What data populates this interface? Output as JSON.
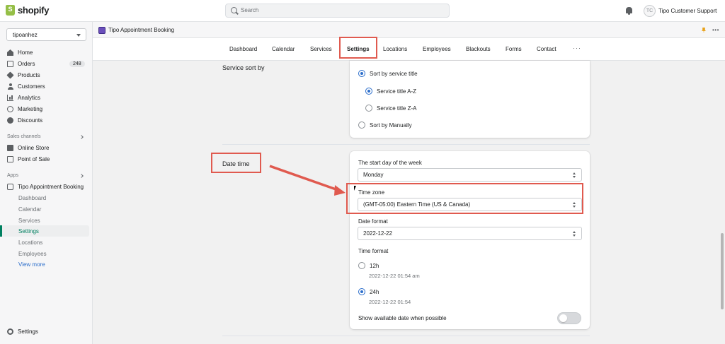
{
  "topbar": {
    "logo_text": "shopify",
    "search_placeholder": "Search",
    "user_initials": "TC",
    "user_name": "Tipo Customer Support"
  },
  "sidebar": {
    "store_name": "tipoanhez",
    "items": [
      {
        "label": "Home",
        "icon": "home-icon"
      },
      {
        "label": "Orders",
        "icon": "orders-icon",
        "badge": "248"
      },
      {
        "label": "Products",
        "icon": "products-icon"
      },
      {
        "label": "Customers",
        "icon": "customers-icon"
      },
      {
        "label": "Analytics",
        "icon": "analytics-icon"
      },
      {
        "label": "Marketing",
        "icon": "marketing-icon"
      },
      {
        "label": "Discounts",
        "icon": "discounts-icon"
      }
    ],
    "sales_channels_label": "Sales channels",
    "sales_channels": [
      {
        "label": "Online Store",
        "icon": "online-store-icon"
      },
      {
        "label": "Point of Sale",
        "icon": "pos-icon"
      }
    ],
    "apps_label": "Apps",
    "app_name": "Tipo Appointment Booking",
    "app_subitems": [
      "Dashboard",
      "Calendar",
      "Services",
      "Settings",
      "Locations",
      "Employees"
    ],
    "active_subitem": "Settings",
    "view_more": "View more",
    "settings_label": "Settings"
  },
  "app_header": {
    "title": "Tipo Appointment Booking"
  },
  "tabs": {
    "items": [
      "Dashboard",
      "Calendar",
      "Services",
      "Settings",
      "Locations",
      "Employees",
      "Blackouts",
      "Forms",
      "Contact"
    ],
    "active": "Settings",
    "more_label": "···"
  },
  "service_sort": {
    "title": "Service sort by",
    "options": [
      {
        "label": "Sort by service title",
        "checked": true
      },
      {
        "label": "Service title A-Z",
        "checked": true
      },
      {
        "label": "Service title Z-A",
        "checked": false
      },
      {
        "label": "Sort by Manually",
        "checked": false
      }
    ]
  },
  "date_time": {
    "title": "Date time",
    "start_day_label": "The start day of the week",
    "start_day_value": "Monday",
    "timezone_label": "Time zone",
    "timezone_value": "(GMT-05:00) Eastern Time (US & Canada)",
    "date_format_label": "Date format",
    "date_format_value": "2022-12-22",
    "time_format_label": "Time format",
    "time_formats": [
      {
        "label": "12h",
        "example": "2022-12-22 01:54 am",
        "checked": false
      },
      {
        "label": "24h",
        "example": "2022-12-22 01:54",
        "checked": true
      }
    ],
    "show_available_label": "Show available date when possible",
    "show_available_on": false
  },
  "colors": {
    "accent": "#2c6ecb",
    "highlight": "#e05a4f",
    "active_nav": "#008060"
  }
}
